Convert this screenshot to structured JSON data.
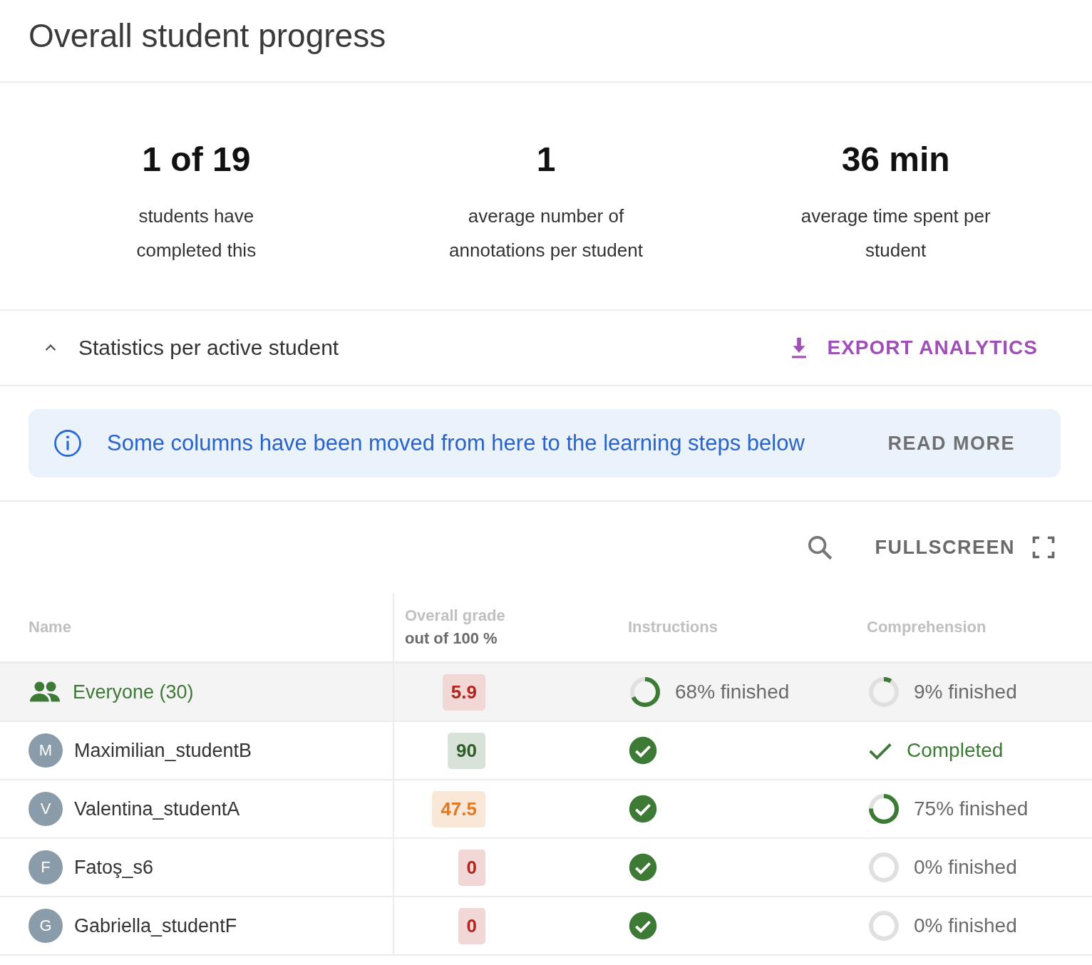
{
  "title": "Overall student progress",
  "stats": [
    {
      "value": "1 of 19",
      "label": "students have completed this"
    },
    {
      "value": "1",
      "label": "average number of annotations per student"
    },
    {
      "value": "36 min",
      "label": "average time spent per student"
    }
  ],
  "section": {
    "title": "Statistics per active student",
    "expanded": true,
    "export_button": "EXPORT ANALYTICS"
  },
  "banner": {
    "message": "Some columns have been moved from here to the learning steps below",
    "action": "READ MORE"
  },
  "toolbar": {
    "fullscreen_button": "FULLSCREEN"
  },
  "table": {
    "columns": [
      {
        "label": "Name"
      },
      {
        "label": "Overall grade",
        "sublabel": "out of 100 %"
      },
      {
        "label": "Instructions"
      },
      {
        "label": "Comprehension"
      }
    ],
    "rows": [
      {
        "kind": "group",
        "name": "Everyone (30)",
        "grade": "5.9",
        "color": "#b0261e",
        "instructions": {
          "kind": "progress",
          "level": 0.68,
          "text": "68% finished"
        },
        "comprehension": {
          "kind": "progress",
          "level": 0.09,
          "text": "9% finished"
        }
      },
      {
        "kind": "student",
        "initial": "M",
        "name": "Maximilian_studentB",
        "grade": "90",
        "color": "#2c5e25",
        "instructions": {
          "kind": "done"
        },
        "comprehension": {
          "kind": "completed",
          "text": "Completed"
        }
      },
      {
        "kind": "student",
        "initial": "V",
        "name": "Valentina_studentA",
        "grade": "47.5",
        "color": "#e07a26",
        "instructions": {
          "kind": "done"
        },
        "comprehension": {
          "kind": "progress",
          "level": 0.75,
          "text": "75% finished"
        }
      },
      {
        "kind": "student",
        "initial": "F",
        "name": "Fatoş_s6",
        "grade": "0",
        "color": "#b0261e",
        "instructions": {
          "kind": "done"
        },
        "comprehension": {
          "kind": "progress",
          "level": 0,
          "text": "0% finished"
        }
      },
      {
        "kind": "student",
        "initial": "G",
        "name": "Gabriella_studentF",
        "grade": "0",
        "color": "#b0261e",
        "instructions": {
          "kind": "done"
        },
        "comprehension": {
          "kind": "progress",
          "level": 0,
          "text": "0% finished"
        }
      }
    ]
  }
}
